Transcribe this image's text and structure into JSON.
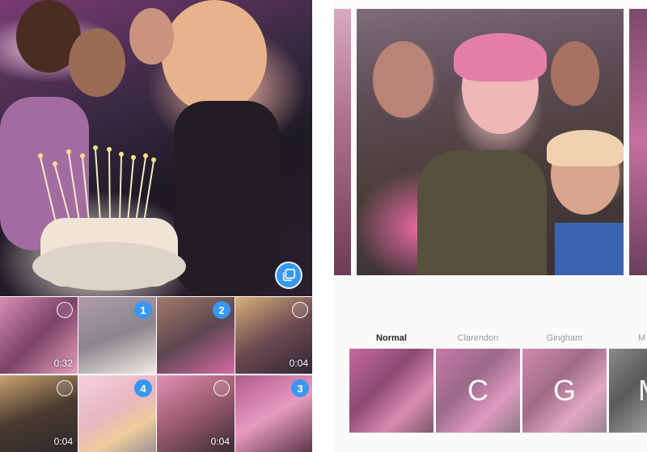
{
  "picker": {
    "multi_select_icon": "multiple-select-icon",
    "tiles": [
      {
        "selected": false,
        "number": "",
        "duration": "0:32"
      },
      {
        "selected": true,
        "number": "1",
        "duration": ""
      },
      {
        "selected": true,
        "number": "2",
        "duration": ""
      },
      {
        "selected": false,
        "number": "",
        "duration": "0:04"
      },
      {
        "selected": false,
        "number": "",
        "duration": "0:04"
      },
      {
        "selected": true,
        "number": "4",
        "duration": ""
      },
      {
        "selected": false,
        "number": "",
        "duration": "0:04"
      },
      {
        "selected": true,
        "number": "3",
        "duration": ""
      }
    ]
  },
  "editor": {
    "filters": [
      {
        "name": "Normal",
        "letter": "",
        "active": true
      },
      {
        "name": "Clarendon",
        "letter": "C",
        "active": false
      },
      {
        "name": "Gingham",
        "letter": "G",
        "active": false
      },
      {
        "name": "M",
        "letter": "M",
        "active": false
      }
    ]
  },
  "colors": {
    "accent": "#3897f0",
    "active_filter_text": "#262626",
    "inactive_filter_text": "#999999",
    "editor_background": "#fafafa"
  }
}
